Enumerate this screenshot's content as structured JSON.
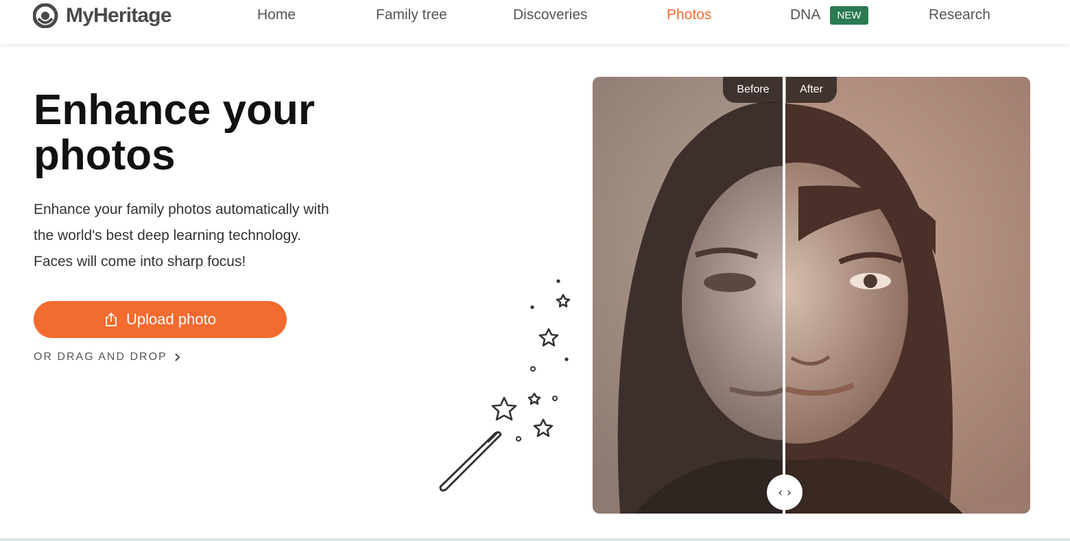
{
  "header": {
    "logo_text": "MyHeritage",
    "nav": {
      "home": "Home",
      "family_tree": "Family tree",
      "discoveries": "Discoveries",
      "photos": "Photos",
      "dna": "DNA",
      "dna_badge": "NEW",
      "research": "Research"
    },
    "active_item": "Photos"
  },
  "hero": {
    "title_line1": "Enhance your",
    "title_line2": "photos",
    "desc_line1": "Enhance your family photos automatically with",
    "desc_line2": "the world's best deep learning technology.",
    "desc_line3": "Faces will come into sharp focus!",
    "upload_label": "Upload photo",
    "drag_drop_label": "OR DRAG AND DROP"
  },
  "comparison": {
    "before_label": "Before",
    "after_label": "After",
    "handle_glyph": "‹ ›"
  },
  "colors": {
    "accent": "#f26b2f",
    "badge": "#2a7a52"
  },
  "icons": [
    "myheritage-logo-icon",
    "upload-icon",
    "chevron-right-icon",
    "magic-wand-icon",
    "slider-handle-icon"
  ]
}
